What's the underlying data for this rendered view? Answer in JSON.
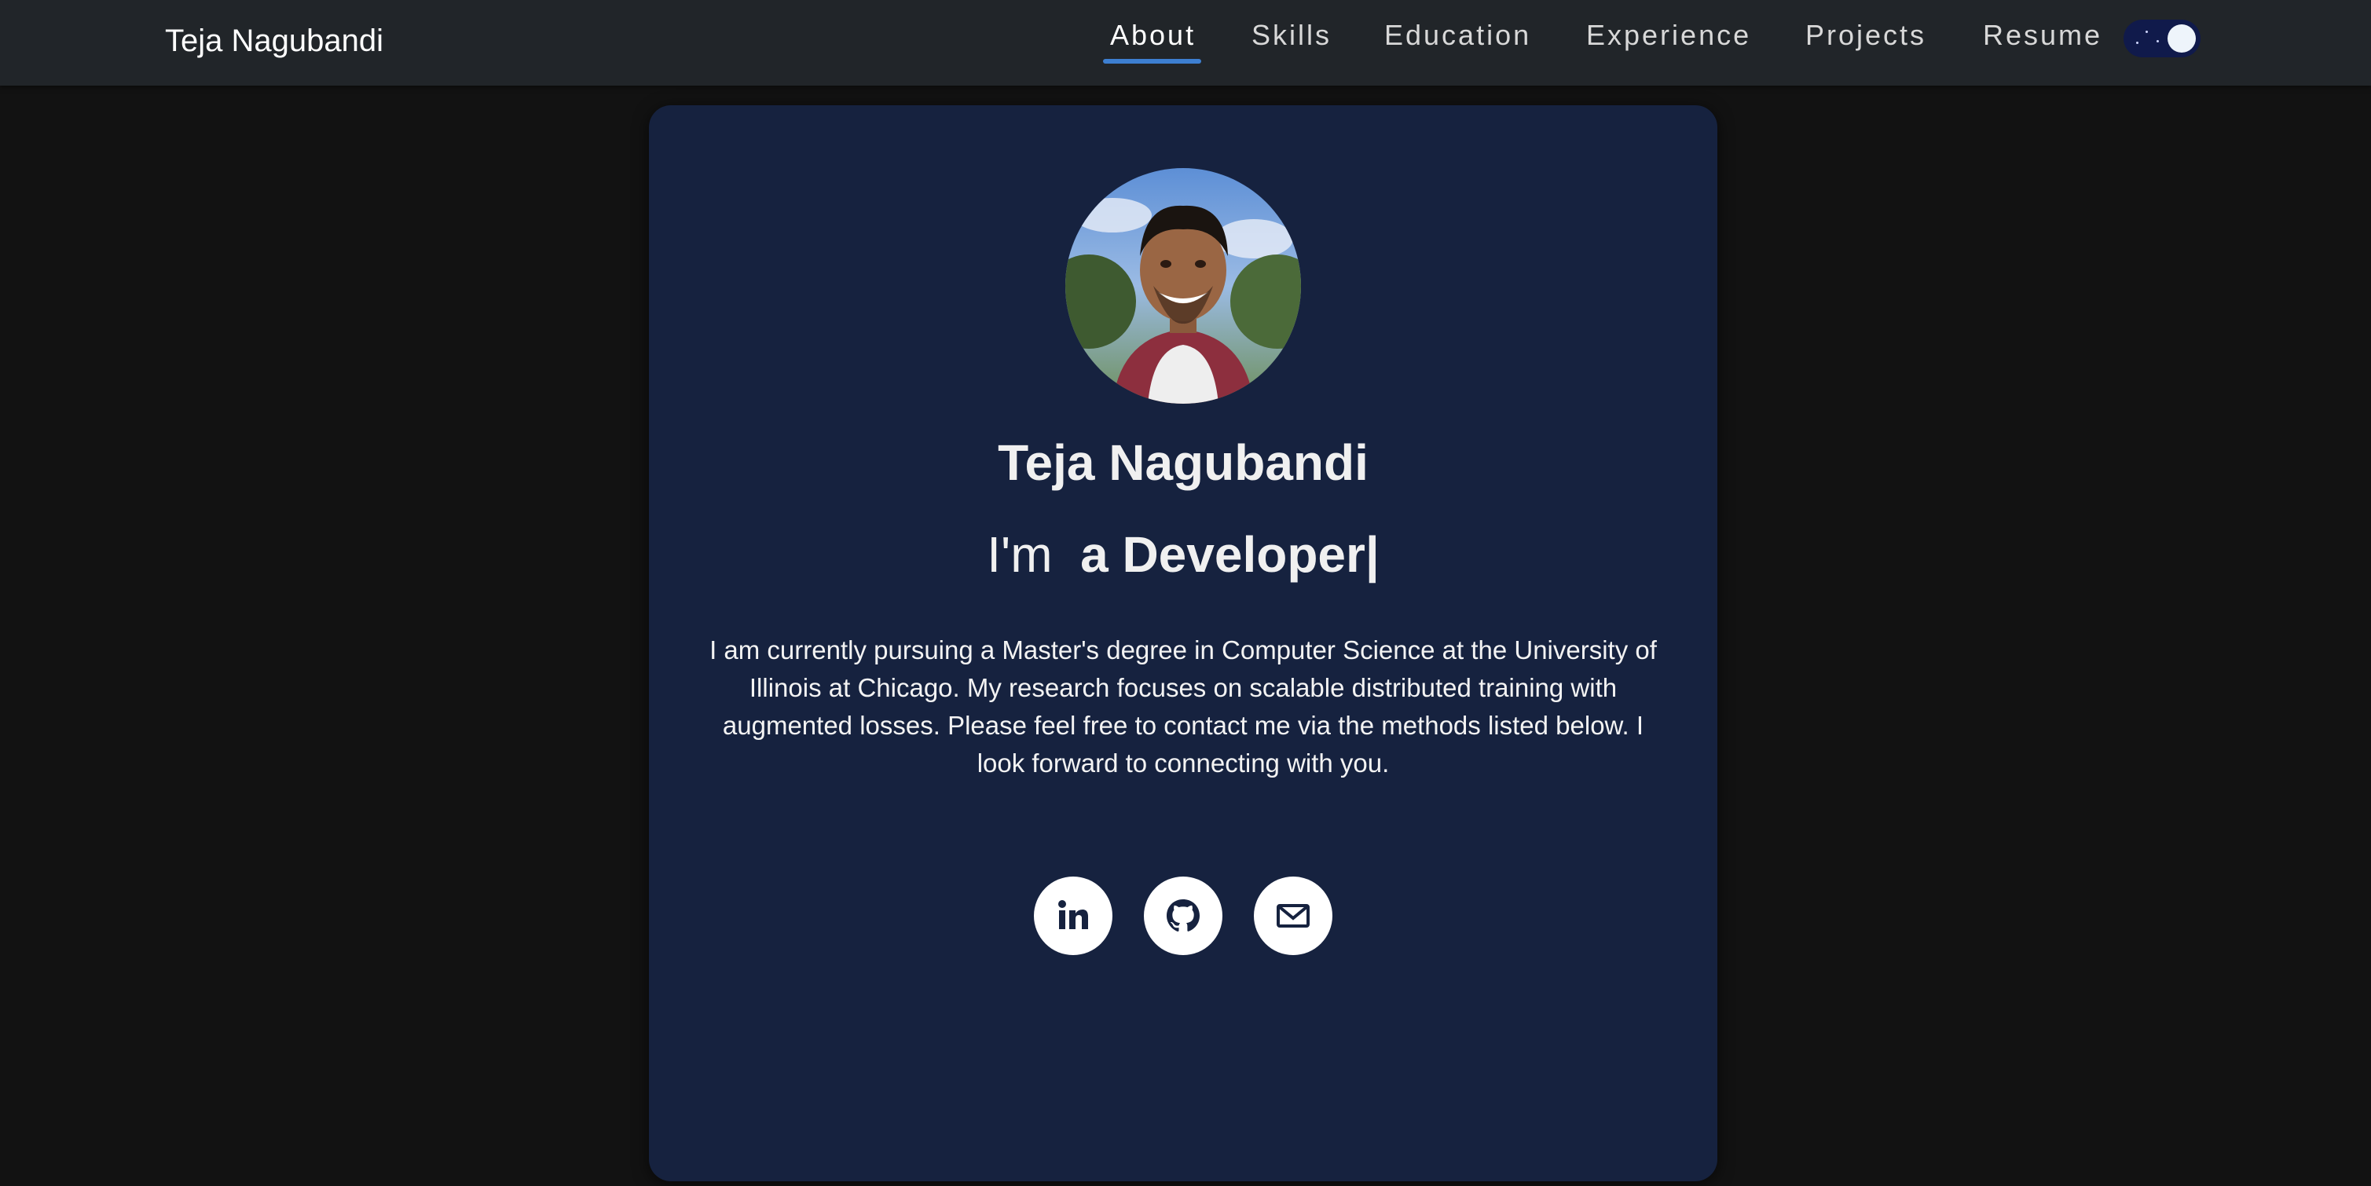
{
  "navbar": {
    "brand": "Teja Nagubandi",
    "links": [
      {
        "label": "About",
        "active": true
      },
      {
        "label": "Skills"
      },
      {
        "label": "Education"
      },
      {
        "label": "Experience"
      },
      {
        "label": "Projects"
      },
      {
        "label": "Resume"
      }
    ],
    "theme_toggle": {
      "icon": "moon-stars-icon",
      "state": "dark"
    }
  },
  "profile": {
    "name": "Teja Nagubandi",
    "tagline_prefix": "I'm",
    "tagline_typed": "a Developer|",
    "bio": "I am currently pursuing a Master's degree in Computer Science at the University of Illinois at Chicago. My research focuses on scalable distributed training with augmented losses. Please feel free to contact me via the methods listed below. I look forward to connecting with you.",
    "socials": [
      {
        "icon": "linkedin-icon"
      },
      {
        "icon": "github-icon"
      },
      {
        "icon": "email-icon"
      }
    ]
  },
  "colors": {
    "page_bg": "#121212",
    "navbar_bg": "#212529",
    "card_bg": "#16223f",
    "accent": "#3d7fd1"
  }
}
